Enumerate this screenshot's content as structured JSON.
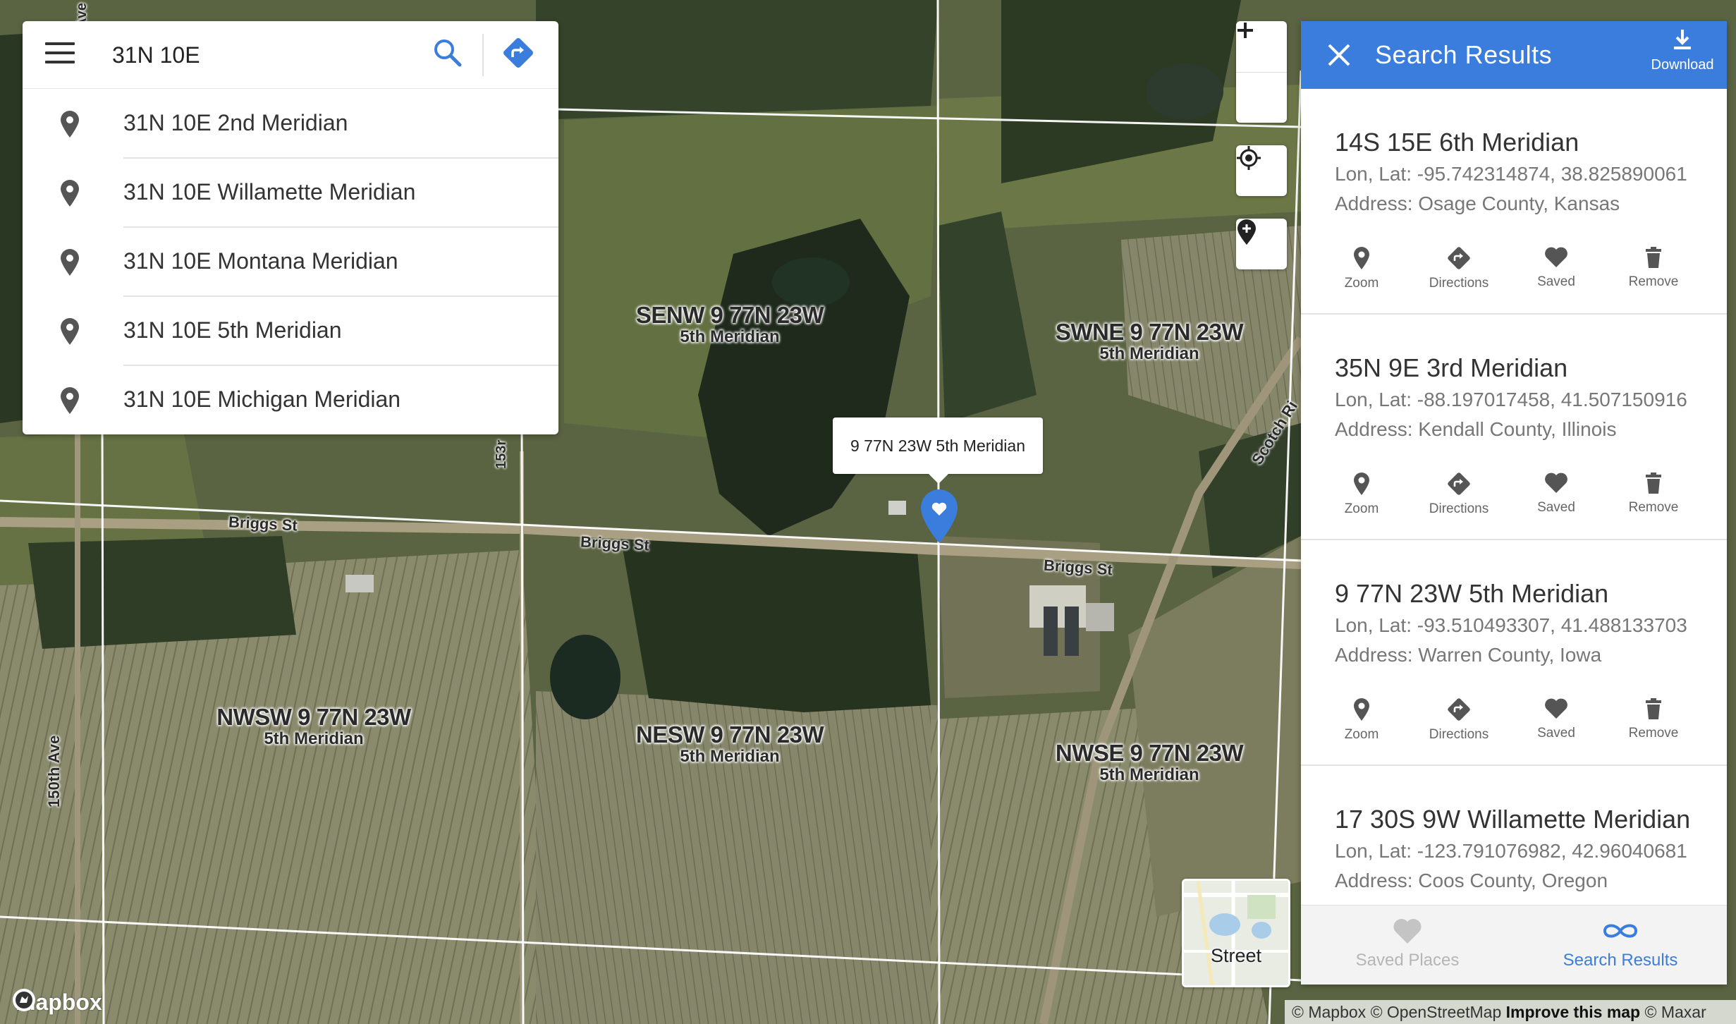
{
  "search": {
    "value": "31N 10E",
    "suggestions": [
      "31N 10E 2nd Meridian",
      "31N 10E Willamette Meridian",
      "31N 10E Montana Meridian",
      "31N 10E 5th Meridian",
      "31N 10E Michigan Meridian"
    ]
  },
  "map": {
    "section_labels": [
      {
        "title": "SENW 9 77N 23W",
        "subtitle": "5th Meridian"
      },
      {
        "title": "SWNE 9 77N 23W",
        "subtitle": "5th Meridian"
      },
      {
        "title": "NWSW 9 77N 23W",
        "subtitle": "5th Meridian"
      },
      {
        "title": "NESW 9 77N 23W",
        "subtitle": "5th Meridian"
      },
      {
        "title": "NWSE 9 77N 23W",
        "subtitle": "5th Meridian"
      }
    ],
    "streets": [
      "Briggs St",
      "Briggs St",
      "Briggs St",
      "150th Ave",
      "153r",
      "Scotch Ri",
      "Ave"
    ],
    "popup": "9 77N 23W 5th Meridian",
    "style_switch_label": "Street",
    "logo_text": "mapbox",
    "attribution": {
      "mapbox": "© Mapbox",
      "osm": "© OpenStreetMap",
      "improve": "Improve this map",
      "maxar": "© Maxar"
    }
  },
  "results": {
    "title": "Search Results",
    "download_label": "Download",
    "items": [
      {
        "name": "14S 15E 6th Meridian",
        "coords": "Lon, Lat: -95.742314874, 38.825890061",
        "address": "Address: Osage County, Kansas"
      },
      {
        "name": "35N 9E 3rd Meridian",
        "coords": "Lon, Lat: -88.197017458, 41.507150916",
        "address": "Address: Kendall County, Illinois"
      },
      {
        "name": "9 77N 23W 5th Meridian",
        "coords": "Lon, Lat: -93.510493307, 41.488133703",
        "address": "Address: Warren County, Iowa"
      },
      {
        "name": "17 30S 9W Willamette Meridian",
        "coords": "Lon, Lat: -123.791076982, 42.96040681",
        "address": "Address: Coos County, Oregon"
      }
    ],
    "actions": [
      "Zoom",
      "Directions",
      "Saved",
      "Remove"
    ],
    "tabs": {
      "saved": "Saved Places",
      "search": "Search Results"
    }
  },
  "colors": {
    "accent": "#3b7ddd",
    "tab_inactive": "#b5b5b5"
  }
}
